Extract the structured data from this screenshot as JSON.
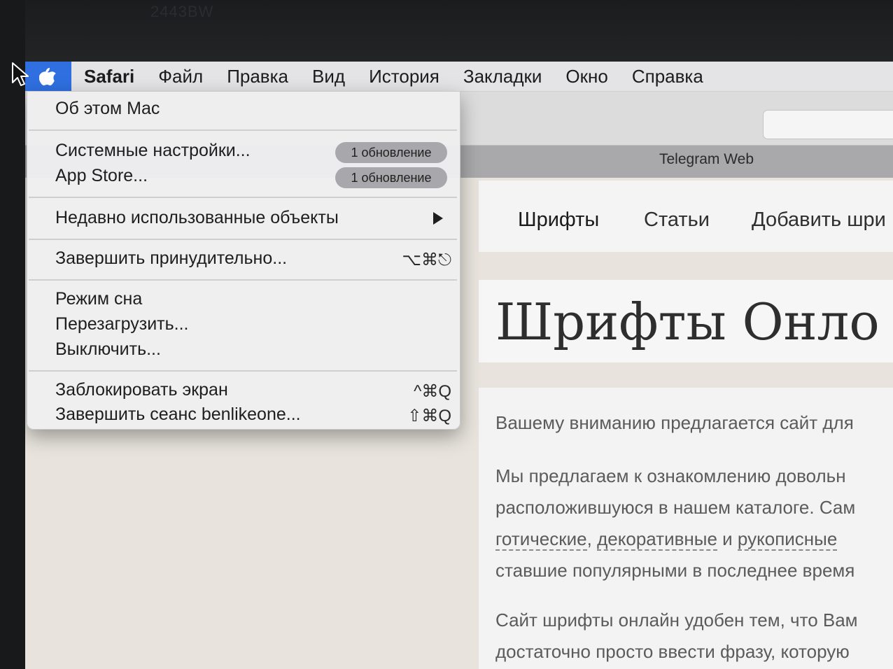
{
  "bezel": {
    "model_text": "2443BW"
  },
  "menubar": {
    "apple_icon": "apple-logo-icon",
    "items": [
      "Safari",
      "Файл",
      "Правка",
      "Вид",
      "История",
      "Закладки",
      "Окно",
      "Справка"
    ]
  },
  "apple_menu": {
    "about": "Об этом Mac",
    "system_prefs": "Системные настройки...",
    "system_prefs_badge": "1 обновление",
    "app_store": "App Store...",
    "app_store_badge": "1 обновление",
    "recent_items": "Недавно использованные объекты",
    "force_quit": "Завершить принудительно...",
    "force_quit_shortcut": "⌥⌘⎋",
    "sleep": "Режим сна",
    "restart": "Перезагрузить...",
    "shutdown": "Выключить...",
    "lock_screen": "Заблокировать экран",
    "lock_screen_shortcut": "^⌘Q",
    "log_out": "Завершить сеанс benlikeone...",
    "log_out_shortcut": "⇧⌘Q"
  },
  "browser": {
    "tab_title": "Telegram Web"
  },
  "website": {
    "nav": [
      "Шрифты",
      "Статьи",
      "Добавить шри"
    ],
    "hero_title": "Шрифты Онло",
    "para1": "Вашему вниманию предлагается сайт для",
    "para2_line1": "Мы предлагаем к ознакомлению довольн",
    "para2_line2": "расположившуюся в нашем каталоге. Сам",
    "para2_link1": "готические",
    "para2_sep1": ", ",
    "para2_link2": "декоративные",
    "para2_sep2": " и ",
    "para2_link3": "рукописные",
    "para2_line4": "ставшие популярными в последнее время",
    "para3_line1": "Сайт шрифты онлайн удобен тем, что Вам",
    "para3_line2": "достаточно просто ввести фразу, которую"
  }
}
